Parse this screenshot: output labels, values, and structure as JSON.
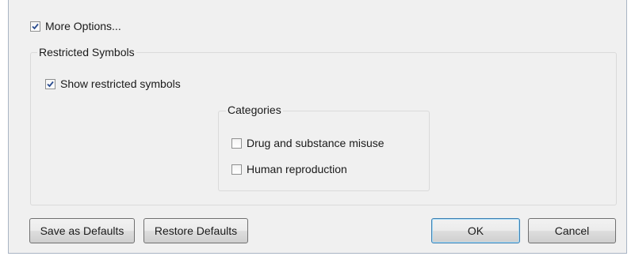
{
  "dialog": {
    "more_options": {
      "label": "More Options...",
      "checked": true
    },
    "restricted_symbols": {
      "title": "Restricted Symbols",
      "show_restricted": {
        "label": "Show restricted symbols",
        "checked": true
      },
      "categories": {
        "title": "Categories",
        "items": [
          {
            "label": "Drug and substance misuse",
            "checked": false
          },
          {
            "label": "Human reproduction",
            "checked": false
          }
        ]
      }
    },
    "buttons": {
      "save_defaults": "Save as Defaults",
      "restore_defaults": "Restore Defaults",
      "ok": "OK",
      "cancel": "Cancel"
    }
  }
}
